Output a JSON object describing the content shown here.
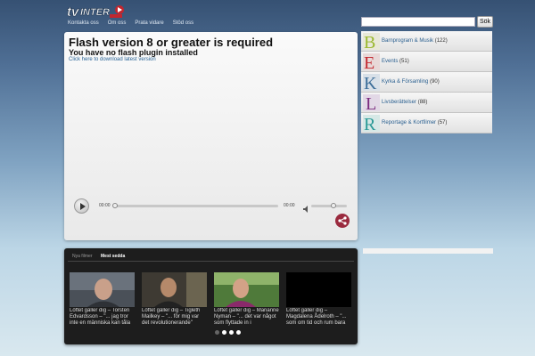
{
  "header": {
    "logo_text": "TV INTER",
    "nav": [
      "Kontakta oss",
      "Om oss",
      "Prata vidare",
      "Stöd oss"
    ]
  },
  "search": {
    "placeholder": "",
    "button_label": "Sök"
  },
  "player": {
    "title": "Flash version 8 or greater is required",
    "subtitle": "You have no flash plugin installed",
    "link": "Click here to download latest version",
    "time_current": "00:00",
    "time_total": "00:00"
  },
  "carousel": {
    "tabs": [
      "Nya filmer",
      "Mest sedda"
    ],
    "items": [
      {
        "label": "Löftet gäller dig – Torsten Edvardsson – \"... jag tror inte en människa kan tåla"
      },
      {
        "label": "Löftet gäller dig – Tigleth Mailkey – \"... för mig var det revolutionerande\""
      },
      {
        "label": "Löftet gäller dig – Marianne Nyman – \"... det var något som flyttade in i"
      },
      {
        "label": "Löftet gäller dig – Magdalena Ådelroth – \"... som om tid och rum bara"
      }
    ],
    "page_count": 4,
    "active_page": 1
  },
  "categories": [
    {
      "letter": "B",
      "name": "Barnprogram & Musik",
      "count": "(122)",
      "color": "#9ab82e"
    },
    {
      "letter": "E",
      "name": "Events",
      "count": "(51)",
      "color": "#c2262e"
    },
    {
      "letter": "K",
      "name": "Kyrka & Församling",
      "count": "(90)",
      "color": "#3d6e99"
    },
    {
      "letter": "L",
      "name": "Livsberättelser",
      "count": "(88)",
      "color": "#7a2a7e"
    },
    {
      "letter": "R",
      "name": "Reportage & Kortfilmer",
      "count": "(57)",
      "color": "#2a9a96"
    }
  ],
  "colors": {
    "share": "#9a2a3e",
    "link": "#2a6496"
  }
}
